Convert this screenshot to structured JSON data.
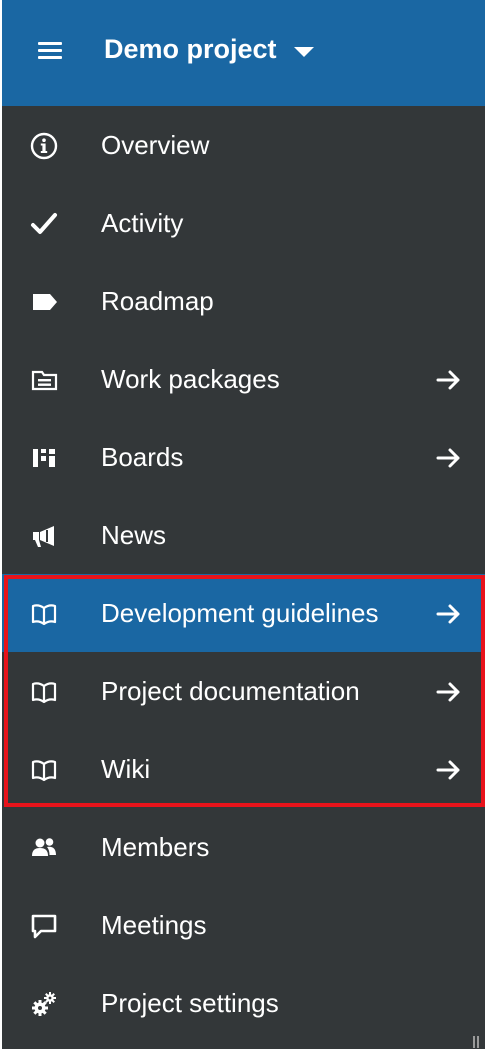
{
  "header": {
    "project_title": "Demo project",
    "background": "#1a67a3"
  },
  "menu": {
    "background": "#333739",
    "active_color": "#1a67a3",
    "highlight_border_color": "#e8131b",
    "items": [
      {
        "label": "Overview",
        "icon": "info-icon",
        "has_arrow": false,
        "active": false
      },
      {
        "label": "Activity",
        "icon": "checkmark-icon",
        "has_arrow": false,
        "active": false
      },
      {
        "label": "Roadmap",
        "icon": "tag-icon",
        "has_arrow": false,
        "active": false
      },
      {
        "label": "Work packages",
        "icon": "work-packages-icon",
        "has_arrow": true,
        "active": false
      },
      {
        "label": "Boards",
        "icon": "boards-icon",
        "has_arrow": true,
        "active": false
      },
      {
        "label": "News",
        "icon": "megaphone-icon",
        "has_arrow": false,
        "active": false
      },
      {
        "label": "Development guidelines",
        "icon": "book-icon",
        "has_arrow": true,
        "active": true
      },
      {
        "label": "Project documentation",
        "icon": "book-icon",
        "has_arrow": true,
        "active": false
      },
      {
        "label": "Wiki",
        "icon": "book-icon",
        "has_arrow": true,
        "active": false
      },
      {
        "label": "Members",
        "icon": "members-icon",
        "has_arrow": false,
        "active": false
      },
      {
        "label": "Meetings",
        "icon": "speech-bubble-icon",
        "has_arrow": false,
        "active": false
      },
      {
        "label": "Project settings",
        "icon": "gears-icon",
        "has_arrow": false,
        "active": false
      }
    ]
  }
}
